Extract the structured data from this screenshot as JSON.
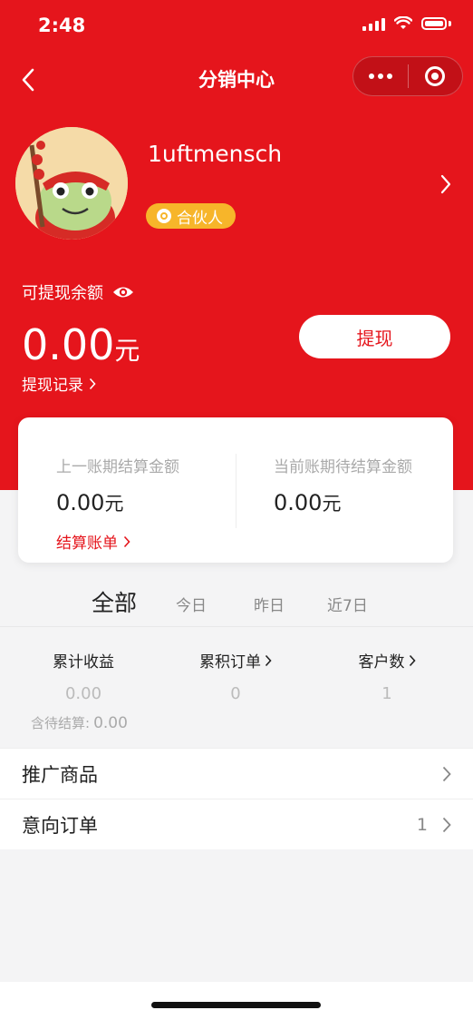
{
  "status_bar": {
    "time": "2:48"
  },
  "header": {
    "title": "分销中心"
  },
  "colors": {
    "primary_red": "#e5151c",
    "badge_gold": "#f7b52a"
  },
  "profile": {
    "username": "1uftmensch",
    "role_badge": "合伙人"
  },
  "balance": {
    "label": "可提现余额",
    "amount": "0.00",
    "unit": "元",
    "withdraw_button": "提现",
    "records_link": "提现记录"
  },
  "settlement": {
    "last_period_label": "上一账期结算金额",
    "last_period_value": "0.00",
    "current_period_label": "当前账期待结算金额",
    "current_period_value": "0.00",
    "unit": "元",
    "bill_link": "结算账单"
  },
  "tabs": [
    "全部",
    "今日",
    "昨日",
    "近7日"
  ],
  "stats": [
    {
      "label": "累计收益",
      "value": "0.00"
    },
    {
      "label": "累积订单",
      "value": "0"
    },
    {
      "label": "客户数",
      "value": "1"
    }
  ],
  "pending": {
    "label": "含待结算:",
    "value": "0.00"
  },
  "menu": [
    {
      "label": "推广商品",
      "count": ""
    },
    {
      "label": "意向订单",
      "count": "1"
    }
  ],
  "icons": [
    "back-icon",
    "more-icon",
    "close-target-icon",
    "eye-icon",
    "chevron-right-icon",
    "partner-badge-icon"
  ]
}
